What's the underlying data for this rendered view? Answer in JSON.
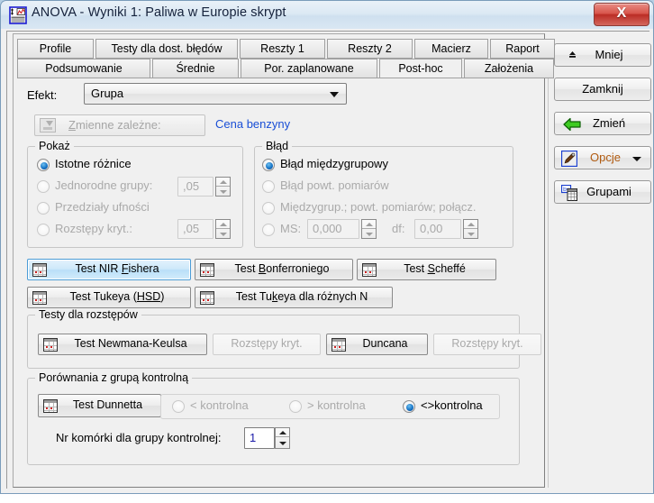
{
  "window": {
    "title": "ANOVA - Wyniki 1: Paliwa w Europie skrypt",
    "icon": "anova-chart-icon",
    "close_label": "X"
  },
  "tabs": {
    "row1": [
      {
        "label": "Profile",
        "active": false
      },
      {
        "label": "Testy dla dost. błędów",
        "active": false
      },
      {
        "label": "Reszty 1",
        "active": false
      },
      {
        "label": "Reszty 2",
        "active": false
      },
      {
        "label": "Macierz",
        "active": false
      },
      {
        "label": "Raport",
        "active": false
      }
    ],
    "row2": [
      {
        "label": "Podsumowanie",
        "active": false
      },
      {
        "label": "Średnie",
        "active": false
      },
      {
        "label": "Por. zaplanowane",
        "active": false
      },
      {
        "label": "Post-hoc",
        "active": true
      },
      {
        "label": "Założenia",
        "active": false
      }
    ]
  },
  "effect": {
    "label": "Efekt:",
    "value": "Grupa",
    "dropdown_icon": "chevron-down-icon"
  },
  "dependent": {
    "button_label": "Zmienne zależne:",
    "value": "Cena benzyny",
    "icon": "variables-icon"
  },
  "show_group": {
    "title": "Pokaż",
    "options": [
      {
        "label": "Istotne różnice",
        "checked": true,
        "disabled": false
      },
      {
        "label": "Jednorodne grupy:",
        "checked": false,
        "disabled": true
      },
      {
        "label": "Przedziały ufności",
        "checked": false,
        "disabled": true
      },
      {
        "label": "Rozstępy kryt.:",
        "checked": false,
        "disabled": true
      }
    ],
    "alpha_homog": ",05",
    "alpha_range": ",05"
  },
  "error_group": {
    "title": "Błąd",
    "options": [
      {
        "label": "Błąd międzygrupowy",
        "checked": true,
        "disabled": false
      },
      {
        "label": "Błąd powt. pomiarów",
        "checked": false,
        "disabled": true
      },
      {
        "label": "Międzygrup.; powt. pomiarów; połącz.",
        "checked": false,
        "disabled": true
      },
      {
        "label": "MS:",
        "checked": false,
        "disabled": true
      }
    ],
    "ms_value": "0,000",
    "df_label": "df:",
    "df_value": "0,00"
  },
  "tests": [
    {
      "label": "Test NIR Fishera",
      "accel": "F",
      "focused": true
    },
    {
      "label": "Test Bonferroniego",
      "accel": "B",
      "focused": false
    },
    {
      "label": "Test Scheffé",
      "accel": "S",
      "focused": false
    },
    {
      "label": "Test Tukeya (HSD)",
      "accel": "HSD",
      "focused": false
    },
    {
      "label": "Test Tukeya dla różnych N",
      "accel": "k",
      "focused": false
    }
  ],
  "range_tests": {
    "title": "Testy dla rozstępów",
    "buttons": [
      {
        "label": "Test Newmana-Keulsa",
        "disabled": false,
        "icon": true
      },
      {
        "label": "Rozstępy kryt.",
        "disabled": true,
        "icon": false
      },
      {
        "label": "Duncana",
        "disabled": false,
        "icon": true
      },
      {
        "label": "Rozstępy kryt.",
        "disabled": true,
        "icon": false
      }
    ]
  },
  "control_group": {
    "title": "Porównania z grupą kontrolną",
    "dunnett_label": "Test Dunnetta",
    "options": [
      {
        "label": "< kontrolna",
        "checked": false,
        "disabled": true
      },
      {
        "label": "> kontrolna",
        "checked": false,
        "disabled": true
      },
      {
        "label": "<>kontrolna",
        "checked": true,
        "disabled": false
      }
    ],
    "cell_label": "Nr komórki dla grupy kontrolnej:",
    "cell_value": "1"
  },
  "right_buttons": [
    {
      "label": "Mniej",
      "icon": "up-arrow-icon",
      "style": "normal"
    },
    {
      "label": "Zamknij",
      "icon": "",
      "style": "normal"
    },
    {
      "label": "Zmień",
      "icon": "green-left-arrow-icon",
      "style": "normal"
    },
    {
      "label": "Opcje",
      "icon": "options-wrench-icon",
      "style": "orange",
      "dropdown": true
    },
    {
      "label": "Grupami",
      "icon": "by-groups-icon",
      "style": "normal"
    }
  ],
  "colors": {
    "accent_blue": "#1a4fd6",
    "focus_blue": "#b9dff8",
    "orange_text": "#b05a10",
    "green_arrow": "#3ecb22",
    "close_red": "#bb2d25"
  }
}
